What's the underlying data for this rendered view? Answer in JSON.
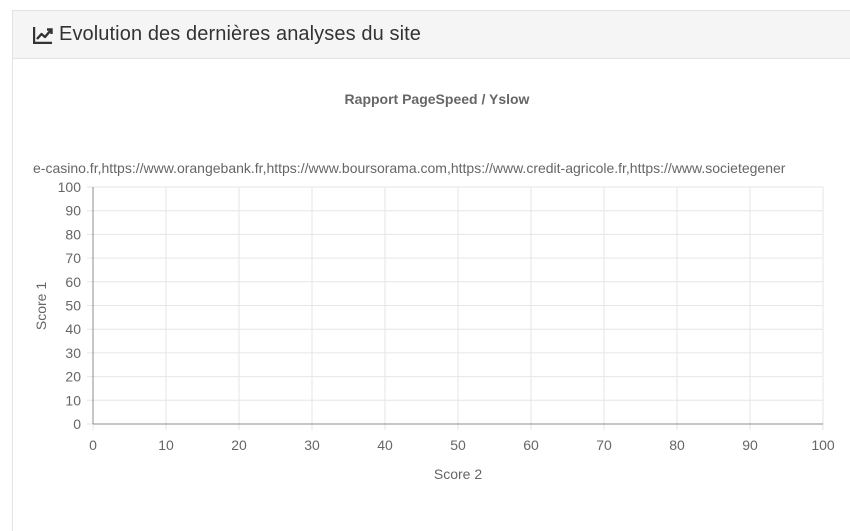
{
  "panel": {
    "title": "Evolution des dernières analyses du site",
    "icon": "line-chart-icon"
  },
  "chart_data": {
    "type": "scatter",
    "title": "Rapport PageSpeed / Yslow",
    "legend_text": "e-casino.fr,https://www.orangebank.fr,https://www.boursorama.com,https://www.credit-agricole.fr,https://www.societegener",
    "legend_placement": "top",
    "xlabel": "Score 2",
    "ylabel": "Score 1",
    "xlim": [
      0,
      100
    ],
    "ylim": [
      0,
      100
    ],
    "x_ticks": [
      "0",
      "10",
      "20",
      "30",
      "40",
      "50",
      "60",
      "70",
      "80",
      "90",
      "100"
    ],
    "y_ticks": [
      "0",
      "10",
      "20",
      "30",
      "40",
      "50",
      "60",
      "70",
      "80",
      "90",
      "100"
    ],
    "grid": true,
    "series": []
  },
  "colors": {
    "grid": "#e6e6e6",
    "axis": "#8c8c8c",
    "text": "#666666"
  }
}
